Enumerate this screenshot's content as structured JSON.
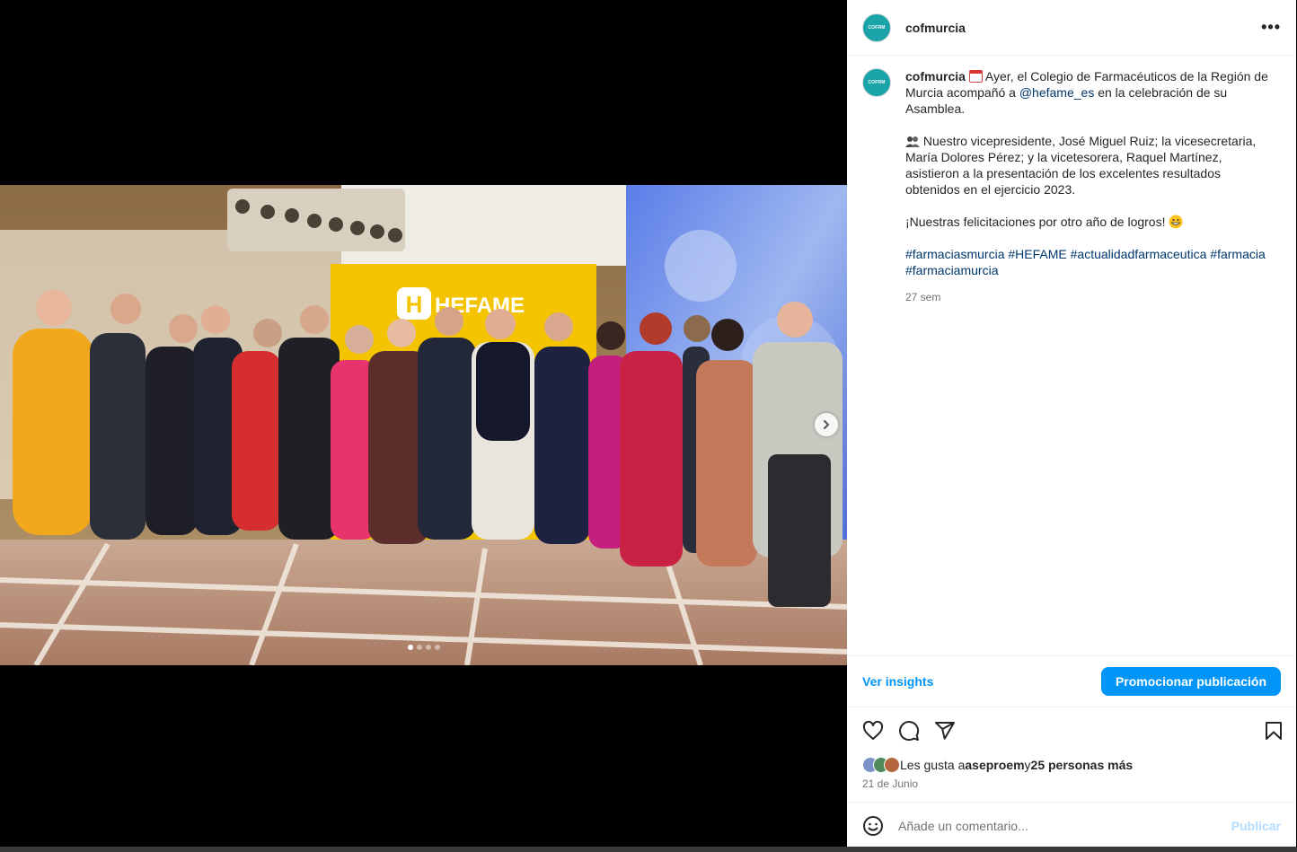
{
  "post": {
    "username": "cofmurcia",
    "avatar_text": "COFRM",
    "more_label": "•••",
    "caption": {
      "line1_text": " Ayer, el Colegio de Farmacéuticos de la Región de Murcia acompañó a ",
      "mention": "@hefame_es",
      "line1_tail": " en la celebración de su Asamblea.",
      "para2": " Nuestro vicepresidente, José Miguel Ruiz; la vicesecretaria, María Dolores Pérez; y la vicetesorera, Raquel Martínez, asistieron a la presentación de los excelentes resultados obtenidos en el ejercicio 2023.",
      "para3": "¡Nuestras felicitaciones por otro año de logros! ",
      "hashtags": [
        "#farmaciasmurcia",
        "#HEFAME",
        "#actualidadfarmaceutica",
        "#farmacia",
        "#farmaciamurcia"
      ]
    },
    "time_ago": "27 sem",
    "insights_label": "Ver insights",
    "promote_label": "Promocionar publicación",
    "likes": {
      "prefix": "Les gusta a ",
      "user": "aseproem",
      "mid": " y ",
      "rest": "25 personas más"
    },
    "date": "21 de Junio",
    "comment_placeholder": "Añade un comentario...",
    "publish_label": "Publicar"
  },
  "photo": {
    "banner_text": "HEFAME",
    "carousel_count": 4,
    "carousel_active": 1
  },
  "icons": {
    "heart": "heart-icon",
    "comment": "comment-icon",
    "share": "share-icon",
    "save": "bookmark-icon",
    "emoji": "emoji-icon",
    "next": "chevron-right-icon"
  },
  "colors": {
    "accent": "#0095f6",
    "link": "#00376b",
    "brand_teal": "#1aa3a8",
    "banner_yellow": "#f5c400"
  }
}
